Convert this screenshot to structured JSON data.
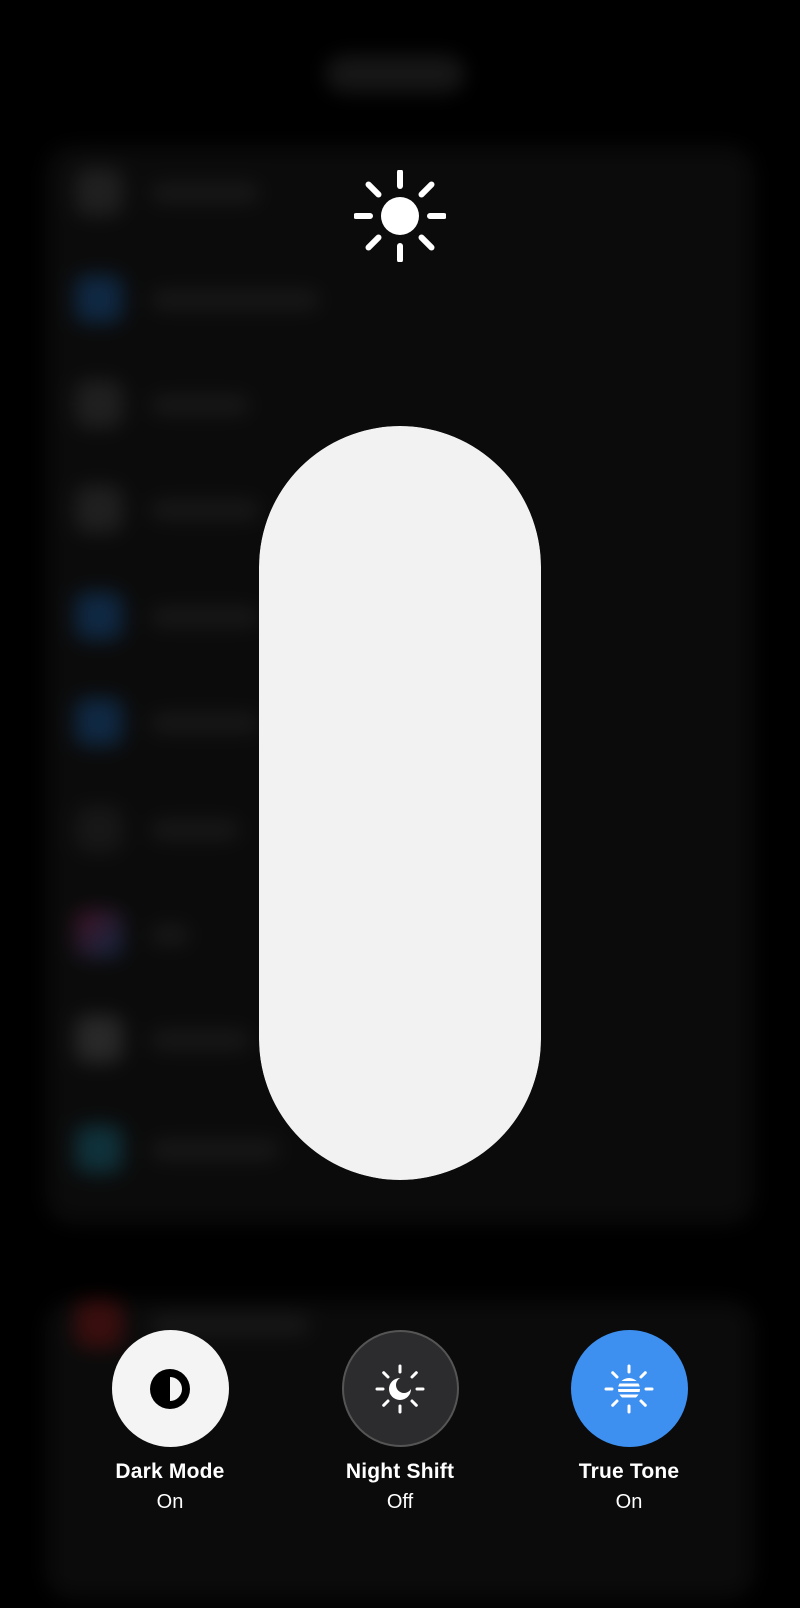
{
  "brightness": {
    "level_percent": 100
  },
  "toggles": {
    "dark_mode": {
      "label": "Dark Mode",
      "state": "On",
      "icon": "dark-mode-icon"
    },
    "night_shift": {
      "label": "Night Shift",
      "state": "Off",
      "icon": "night-shift-icon"
    },
    "true_tone": {
      "label": "True Tone",
      "state": "On",
      "icon": "true-tone-icon"
    }
  },
  "colors": {
    "true_tone_active": "#3d8ff0",
    "dark_mode_active": "#f4f4f4",
    "inactive": "#2c2c2e"
  }
}
